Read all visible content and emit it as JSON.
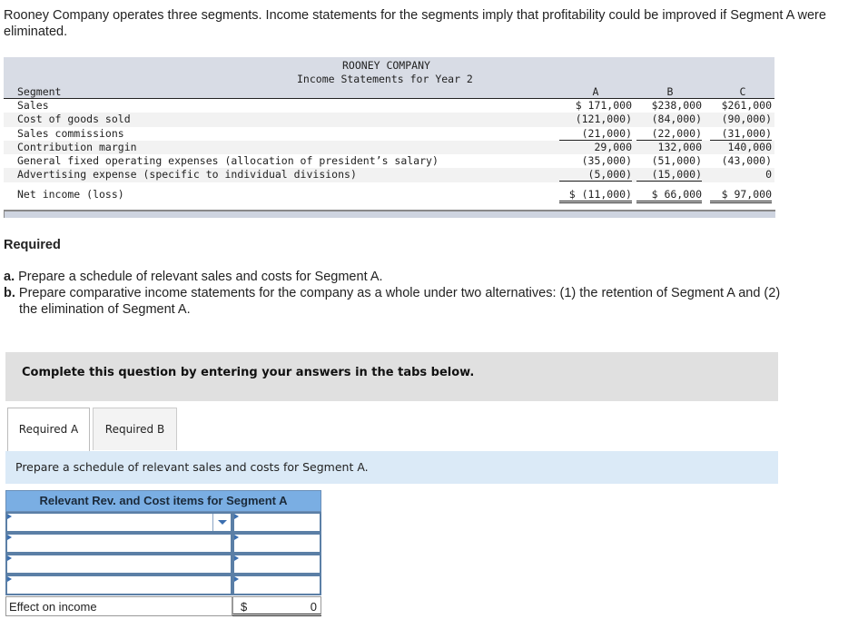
{
  "intro": "Rooney Company operates three segments. Income statements for the segments imply that profitability could be improved if Segment A were eliminated.",
  "statement": {
    "company": "ROONEY COMPANY",
    "title": "Income Statements for Year 2",
    "segment_label": "Segment",
    "columns": [
      "A",
      "B",
      "C"
    ],
    "rows": [
      {
        "label": "Sales",
        "values": [
          "$ 171,000",
          "$238,000",
          "$261,000"
        ]
      },
      {
        "label": "Cost of goods sold",
        "values": [
          "(121,000)",
          "(84,000)",
          "(90,000)"
        ]
      },
      {
        "label": "Sales commissions",
        "values": [
          "(21,000)",
          "(22,000)",
          "(31,000)"
        ]
      },
      {
        "label": "Contribution margin",
        "values": [
          "29,000",
          "132,000",
          "140,000"
        ]
      },
      {
        "label": "General fixed operating expenses (allocation of president’s salary)",
        "values": [
          "(35,000)",
          "(51,000)",
          "(43,000)"
        ]
      },
      {
        "label": "Advertising expense (specific to individual divisions)",
        "values": [
          "(5,000)",
          "(15,000)",
          "0"
        ]
      },
      {
        "label": "Net income (loss)",
        "values": [
          "$ (11,000)",
          "$ 66,000",
          "$ 97,000"
        ]
      }
    ]
  },
  "required": {
    "heading": "Required",
    "a_prefix": "a.",
    "a_text": " Prepare a schedule of relevant sales and costs for Segment A.",
    "b_prefix": "b.",
    "b_text": " Prepare comparative income statements for the company as a whole under two alternatives: (1) the retention of Segment A and (2)",
    "b_text2": "the elimination of Segment A."
  },
  "banner": "Complete this question by entering your answers in the tabs below.",
  "tabs": [
    {
      "label": "Required A",
      "active": true
    },
    {
      "label": "Required B",
      "active": false
    }
  ],
  "instruction": "Prepare a schedule of relevant sales and costs for Segment A.",
  "schedule": {
    "header": "Relevant Rev. and Cost items for Segment A",
    "rows": [
      {
        "item": "",
        "amount": ""
      },
      {
        "item": "",
        "amount": ""
      },
      {
        "item": "",
        "amount": ""
      },
      {
        "item": "",
        "amount": ""
      }
    ],
    "total_label": "Effect on income",
    "total_currency": "$",
    "total_value": "0"
  }
}
